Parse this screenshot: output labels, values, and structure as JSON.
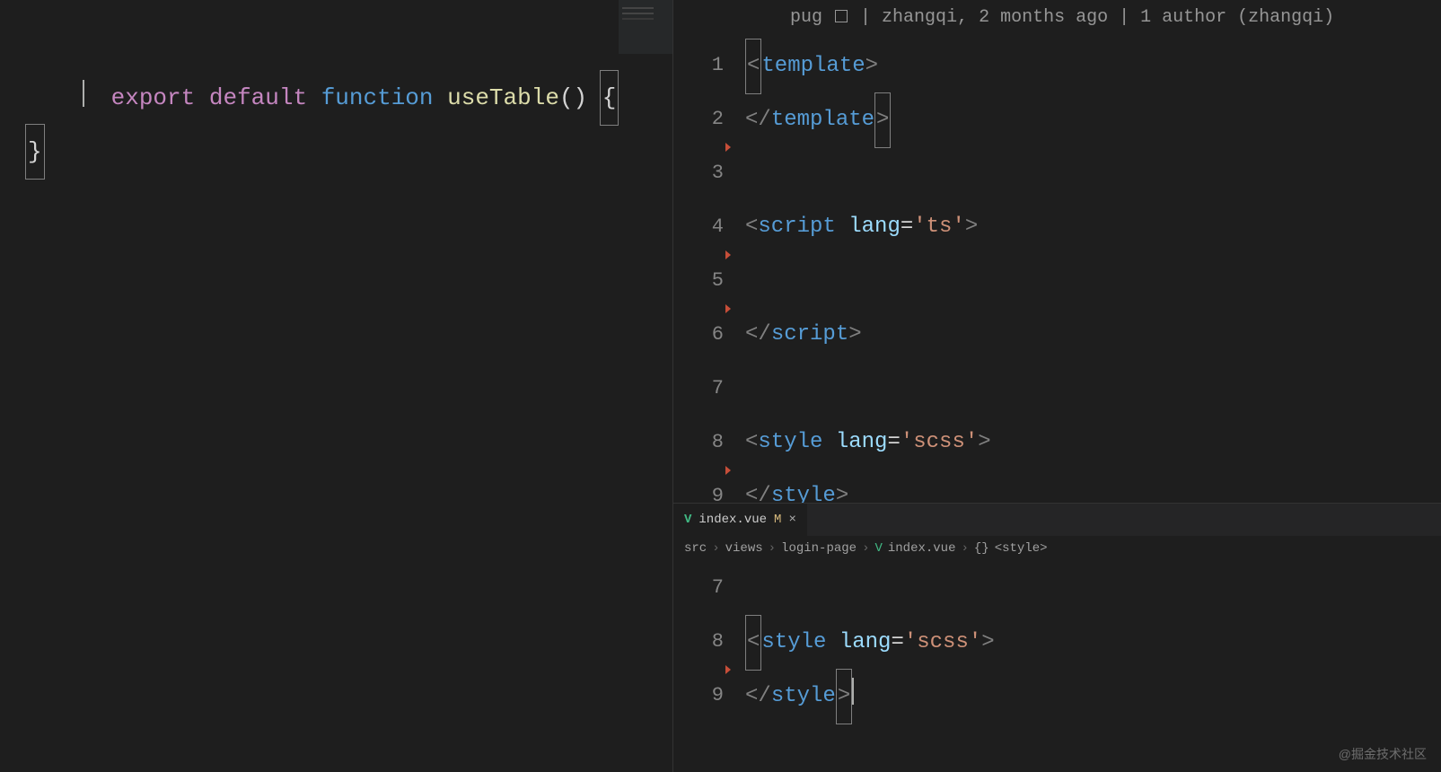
{
  "left_editor": {
    "lines": [
      {
        "kw1": "export",
        "kw2": "default",
        "kw3": "function",
        "fn": "useTable",
        "parens": "()",
        "brace_open": "{"
      },
      {
        "cursor_indent": "    "
      },
      {
        "brace_close": "}"
      }
    ]
  },
  "right_top": {
    "codelens": {
      "prefix": "pug",
      "rest": "| zhangqi, 2 months ago | 1 author (zhangqi)"
    },
    "lines": [
      {
        "n": "1",
        "tokens": [
          {
            "t": "brack",
            "v": "<"
          },
          {
            "t": "tag",
            "v": "template"
          },
          {
            "t": "brack",
            "v": ">"
          }
        ],
        "hl_start": true
      },
      {
        "n": "2",
        "tokens": [
          {
            "t": "brack",
            "v": "</"
          },
          {
            "t": "tag",
            "v": "template"
          },
          {
            "t": "brack",
            "v": ">"
          }
        ],
        "hl_end": true,
        "tri": true
      },
      {
        "n": "3",
        "tokens": []
      },
      {
        "n": "4",
        "tokens": [
          {
            "t": "brack",
            "v": "<"
          },
          {
            "t": "tag",
            "v": "script"
          },
          {
            "t": "punc",
            "v": " "
          },
          {
            "t": "attr",
            "v": "lang"
          },
          {
            "t": "punc",
            "v": "="
          },
          {
            "t": "str",
            "v": "'ts'"
          },
          {
            "t": "brack",
            "v": ">"
          }
        ],
        "tri": true
      },
      {
        "n": "5",
        "tokens": [],
        "tri": true
      },
      {
        "n": "6",
        "tokens": [
          {
            "t": "brack",
            "v": "</"
          },
          {
            "t": "tag",
            "v": "script"
          },
          {
            "t": "brack",
            "v": ">"
          }
        ]
      },
      {
        "n": "7",
        "tokens": []
      },
      {
        "n": "8",
        "tokens": [
          {
            "t": "brack",
            "v": "<"
          },
          {
            "t": "tag",
            "v": "style"
          },
          {
            "t": "punc",
            "v": " "
          },
          {
            "t": "attr",
            "v": "lang"
          },
          {
            "t": "punc",
            "v": "="
          },
          {
            "t": "str",
            "v": "'scss'"
          },
          {
            "t": "brack",
            "v": ">"
          }
        ],
        "tri": true
      },
      {
        "n": "9",
        "tokens": [
          {
            "t": "brack",
            "v": "</"
          },
          {
            "t": "tag",
            "v": "style"
          },
          {
            "t": "brack",
            "v": ">"
          }
        ]
      }
    ]
  },
  "right_bottom": {
    "tab": {
      "filename": "index.vue",
      "status": "M",
      "close": "×"
    },
    "breadcrumb": {
      "p1": "src",
      "p2": "views",
      "p3": "login-page",
      "p4": "index.vue",
      "p5": "<style>",
      "sep": "›",
      "sym": "{}"
    },
    "lines": [
      {
        "n": "7",
        "tokens": []
      },
      {
        "n": "8",
        "tokens": [
          {
            "t": "brack",
            "v": "<"
          },
          {
            "t": "tag",
            "v": "style"
          },
          {
            "t": "punc",
            "v": " "
          },
          {
            "t": "attr",
            "v": "lang"
          },
          {
            "t": "punc",
            "v": "="
          },
          {
            "t": "str",
            "v": "'scss'"
          },
          {
            "t": "brack",
            "v": ">"
          }
        ],
        "hl_start": true,
        "tri": true
      },
      {
        "n": "9",
        "tokens": [
          {
            "t": "brack",
            "v": "</"
          },
          {
            "t": "tag",
            "v": "style"
          },
          {
            "t": "brack",
            "v": ">"
          }
        ],
        "hl_end": true,
        "cursor": true
      }
    ]
  },
  "watermark": "@掘金技术社区"
}
